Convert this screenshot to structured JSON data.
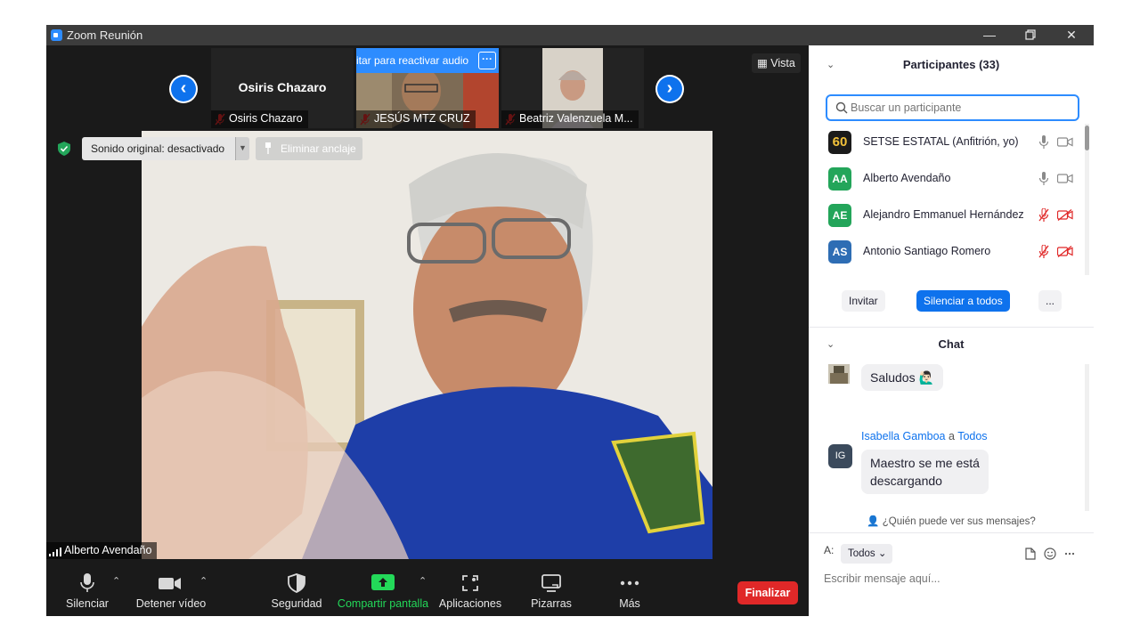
{
  "window": {
    "title": "Zoom Reunión"
  },
  "strip": {
    "thumbs": [
      {
        "big_name": "Osiris Chazaro",
        "label": "Osiris Chazaro"
      },
      {
        "label": "JESÚS MTZ CRUZ",
        "banner": "itar para reactivar audio",
        "banner_more": "···"
      },
      {
        "label": "Beatriz Valenzuela M..."
      }
    ],
    "prev_arrow": "‹",
    "next_arrow": "›"
  },
  "view_button": "Vista",
  "sound_original": "Sonido original: desactivado",
  "unpin": "Eliminar anclaje",
  "speaker_name": "Alberto Avendaño",
  "toolbar": {
    "mute": "Silenciar",
    "video": "Detener vídeo",
    "security": "Seguridad",
    "share": "Compartir pantalla",
    "apps": "Aplicaciones",
    "whiteboards": "Pizarras",
    "more": "Más",
    "end": "Finalizar"
  },
  "participants": {
    "header": "Participantes (33)",
    "search_placeholder": "Buscar un participante",
    "list": [
      {
        "initials": "60",
        "name": "SETSE ESTATAL (Anfitrión, yo)",
        "color": "#1b1b1b",
        "muted": false
      },
      {
        "initials": "AA",
        "name": "Alberto Avendaño",
        "color": "#23a55a",
        "muted": false
      },
      {
        "initials": "AE",
        "name": "Alejandro Emmanuel Hernández",
        "color": "#23a55a",
        "muted": true
      },
      {
        "initials": "AS",
        "name": "Antonio Santiago Romero",
        "color": "#2e6db4",
        "muted": true
      }
    ],
    "invite": "Invitar",
    "mute_all": "Silenciar a todos",
    "more": "..."
  },
  "chat": {
    "header": "Chat",
    "messages": [
      {
        "text": "Saludos 🙋🏻‍♂️"
      },
      {
        "sender": "Isabella Gamboa",
        "to_word": "a",
        "to": "Todos",
        "initials": "IG",
        "text_line1": "Maestro se me está",
        "text_line2": "descargando"
      }
    ],
    "who_can_see": "¿Quién puede ver sus mensajes?",
    "to_label": "A:",
    "to_value": "Todos",
    "input_placeholder": "Escribir mensaje aquí..."
  },
  "colors": {
    "accent": "#0e72ed",
    "end": "#e02828",
    "share": "#23d959"
  }
}
